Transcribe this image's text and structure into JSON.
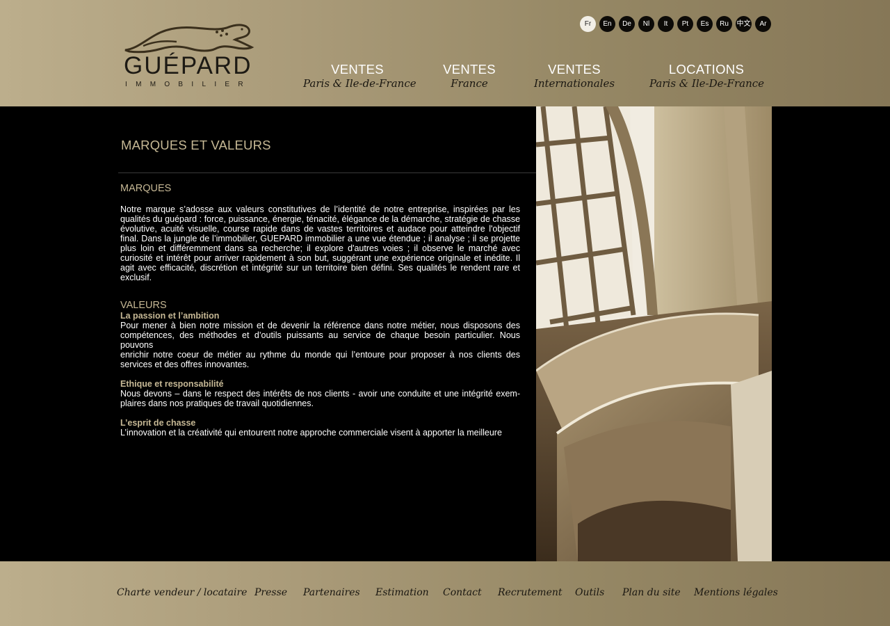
{
  "brand": {
    "name": "GUÉPARD",
    "subtitle": "IMMOBILIER",
    "colors": {
      "gold": "#c6b895",
      "header_left": "#bcae8c",
      "header_right": "#867757",
      "background": "#000000"
    }
  },
  "languages": [
    "Fr",
    "En",
    "De",
    "Nl",
    "It",
    "Pt",
    "Es",
    "Ru",
    "中文",
    "Ar"
  ],
  "active_language": "Fr",
  "nav": [
    {
      "main": "VENTES",
      "sub": "Paris & Ile-de-France"
    },
    {
      "main": "VENTES",
      "sub": "France"
    },
    {
      "main": "VENTES",
      "sub": "Internationales"
    },
    {
      "main": "LOCATIONS",
      "sub": "Paris & Ile-De-France"
    }
  ],
  "page": {
    "title": "MARQUES ET VALEURS",
    "marques": {
      "heading": "MARQUES",
      "text": "Notre marque s’adosse aux valeurs constitutives de l’identité de notre entreprise, inspirées par les qualités du guépard : force, puissance, énergie, ténacité, élégance de la démarche, stratégie de chasse évolutive, acuité visuelle, course rapide dans de vastes territoires et audace pour atteindre l'objectif final. Dans la jungle de l’immobilier, GUEPARD immobilier a une vue étendue ; il analyse ; il se projette plus loin et différemment dans sa recherche; il explore d'autres voies ; il observe le marché avec curiosité et intérêt pour arriver rapidement à son but, suggérant une expérience originale et inédite. Il agit avec efficacité, discrétion et intégrité sur un territoire bien défini. Ses qualités le rendent rare et exclusif."
    },
    "valeurs": {
      "heading": "VALEURS",
      "items": [
        {
          "title": "La passion et l’ambition",
          "line1": "Pour mener à bien notre mission et de devenir la référence dans notre métier, nous disposons des compétences, des méthodes et d’outils puissants au service de chaque besoin particulier. Nous pouvons",
          "line2": "enrichir notre coeur de métier au rythme du monde qui l’entoure pour proposer à nos clients des services et des offres innovantes."
        },
        {
          "title": "Ethique et responsabilité",
          "line1": "Nous devons – dans le respect des intérêts de nos clients - avoir une conduite et une intégrité exem-plaires dans nos pratiques de travail quotidiennes.",
          "line2": ""
        },
        {
          "title": "L’esprit de chasse",
          "line1": "L’innovation et la créativité qui entourent notre approche commerciale visent à apporter la meilleure",
          "line2": ""
        }
      ]
    }
  },
  "footer": [
    "Charte vendeur / locataire",
    "Presse",
    "Partenaires",
    "Estimation",
    "Contact",
    "Recrutement",
    "Outils",
    "Plan du site",
    "Mentions légales"
  ]
}
